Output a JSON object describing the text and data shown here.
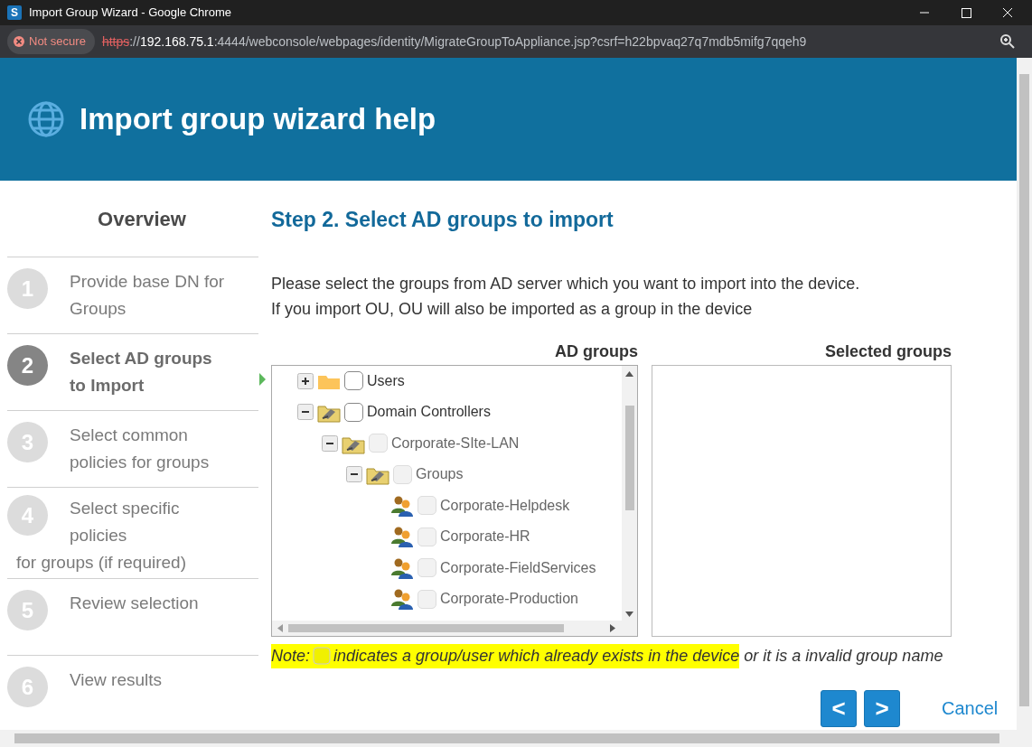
{
  "window": {
    "app_letter": "S",
    "title": "Import Group Wizard - Google Chrome"
  },
  "address_bar": {
    "security": "Not secure",
    "url_scheme": "https",
    "url_sep": "://",
    "url_host": "192.168.75.1",
    "url_rest": ":4444/webconsole/webpages/identity/MigrateGroupToAppliance.jsp?csrf=h22bpvaq27q7mdb5mifg7qqeh9"
  },
  "header": {
    "title": "Import group wizard help"
  },
  "sidebar": {
    "title": "Overview",
    "steps": [
      {
        "number": "1",
        "lines": [
          "Provide base DN for",
          "Groups"
        ],
        "selected": false
      },
      {
        "number": "2",
        "lines": [
          "Select AD groups",
          "to  Import"
        ],
        "selected": true
      },
      {
        "number": "3",
        "lines": [
          "Select common",
          "policies  for groups"
        ],
        "selected": false
      },
      {
        "number": "4",
        "lines": [
          "Select specific",
          "policies",
          "for groups (if required)"
        ],
        "selected": false
      },
      {
        "number": "5",
        "lines": [
          "Review selection"
        ],
        "selected": false
      },
      {
        "number": "6",
        "lines": [
          "View results"
        ],
        "selected": false
      }
    ]
  },
  "main": {
    "heading": "Step 2. Select AD groups to import",
    "description": [
      "Please select the groups from AD server which you want to import into the device.",
      "If you import OU, OU will also be imported as a group in the device"
    ],
    "tree_title": "AD groups",
    "selected_title": "Selected groups",
    "tree": [
      {
        "kind": "folder",
        "label": "Users",
        "expanded": false,
        "disabled": false
      },
      {
        "kind": "ou",
        "label": "Domain Controllers",
        "expanded": true,
        "disabled": false,
        "children": [
          {
            "kind": "ou",
            "label": "Corporate-SIte-LAN",
            "expanded": true,
            "disabled": true,
            "children": [
              {
                "kind": "ou",
                "label": "Groups",
                "expanded": true,
                "disabled": true,
                "children": [
                  {
                    "kind": "group",
                    "label": "Corporate-Helpdesk",
                    "disabled": true
                  },
                  {
                    "kind": "group",
                    "label": "Corporate-HR",
                    "disabled": true
                  },
                  {
                    "kind": "group",
                    "label": "Corporate-FieldServices",
                    "disabled": true
                  },
                  {
                    "kind": "group",
                    "label": "Corporate-Production",
                    "disabled": true
                  }
                ]
              }
            ]
          }
        ]
      }
    ],
    "note": {
      "label": "Note:",
      "highlighted": "indicates a group/user which already exists in the device",
      "rest": "or it is a invalid group name"
    },
    "buttons": {
      "back": "<",
      "next": ">",
      "cancel": "Cancel"
    }
  }
}
